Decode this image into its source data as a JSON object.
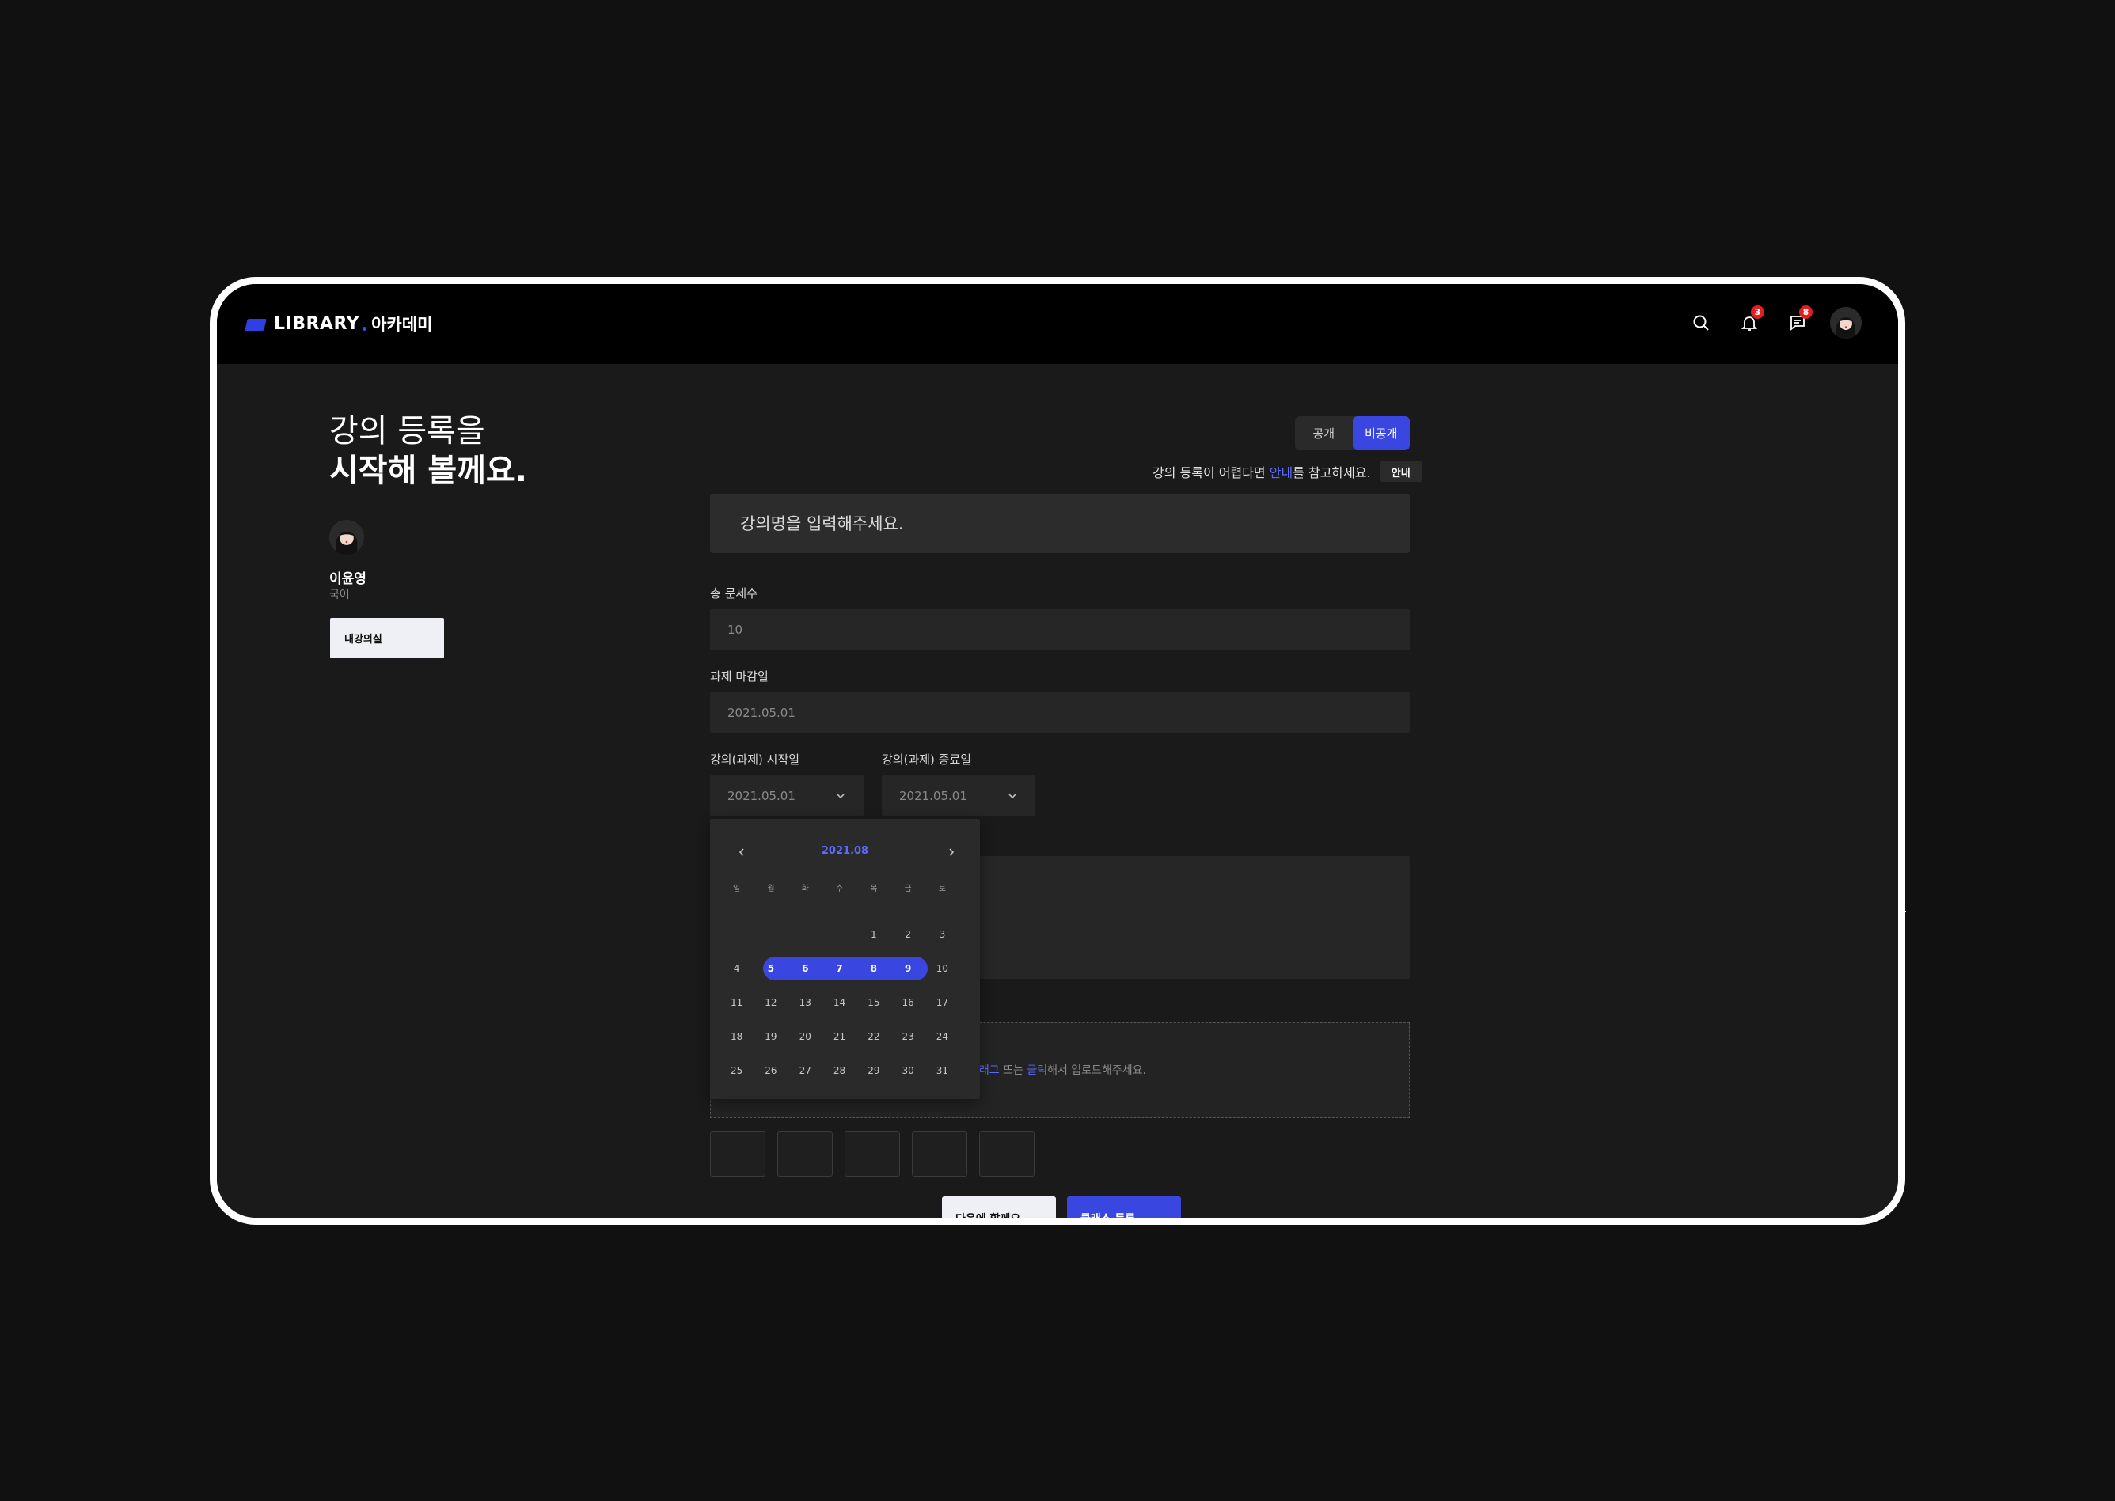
{
  "brand": {
    "name": "LIBRARY",
    "sub": "아카데미"
  },
  "topbar": {
    "notification_count": "3",
    "message_count": "8"
  },
  "headline": {
    "line1": "강의 등록을",
    "line2": "시작해 볼께요."
  },
  "profile": {
    "name": "이윤영",
    "subject": "국어",
    "my_class_label": "내강의실"
  },
  "visibility": {
    "public_label": "공개",
    "private_label": "비공개",
    "selected": "비공개"
  },
  "guide": {
    "prefix": "강의 등록이 어렵다면 ",
    "link": "안내",
    "suffix": "를 참고하세요.",
    "button": "안내"
  },
  "form": {
    "title_placeholder": "강의명을 입력해주세요.",
    "total_questions_label": "총 문제수",
    "total_questions_value": "10",
    "deadline_label": "과제 마감일",
    "deadline_value": "2021.05.01",
    "start_label": "강의(과제) 시작일",
    "start_value": "2021.05.01",
    "end_label": "강의(과제) 종료일",
    "end_value": "2021.05.01"
  },
  "calendar": {
    "month": "2021.08",
    "weekdays": [
      "일",
      "월",
      "화",
      "수",
      "목",
      "금",
      "토"
    ],
    "weeks": [
      [
        "",
        "",
        "",
        "",
        "1",
        "2",
        "3"
      ],
      [
        "4",
        "5",
        "6",
        "7",
        "8",
        "9",
        "10"
      ],
      [
        "11",
        "12",
        "13",
        "14",
        "15",
        "16",
        "17"
      ],
      [
        "18",
        "19",
        "20",
        "21",
        "22",
        "23",
        "24"
      ],
      [
        "25",
        "26",
        "27",
        "28",
        "29",
        "30",
        "31"
      ]
    ],
    "selected_range": [
      "5",
      "9"
    ]
  },
  "upload": {
    "drag": "드래그",
    "or": " 또는 ",
    "click": "클릭",
    "suffix": "해서 업로드해주세요."
  },
  "actions": {
    "later": "다음에 할께요",
    "register": "클래스 등록"
  },
  "colors": {
    "accent": "#3a46e0",
    "link": "#5c6cff",
    "badge": "#e02020"
  }
}
